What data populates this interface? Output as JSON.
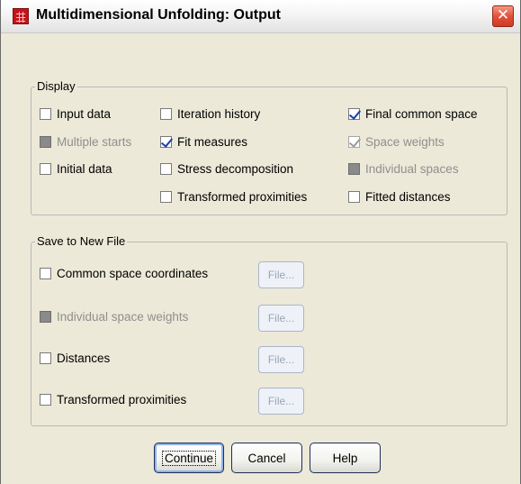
{
  "window": {
    "title": "Multidimensional Unfolding: Output",
    "close_symbol": "✕",
    "icon": "spreadsheet-icon"
  },
  "display": {
    "legend": "Display",
    "items": [
      {
        "label": "Input data",
        "checked": false,
        "enabled": true
      },
      {
        "label": "Multiple starts",
        "checked": false,
        "enabled": false
      },
      {
        "label": "Initial data",
        "checked": false,
        "enabled": true
      },
      {
        "label": "Iteration history",
        "checked": false,
        "enabled": true
      },
      {
        "label": "Fit measures",
        "checked": true,
        "enabled": true
      },
      {
        "label": "Stress decomposition",
        "checked": false,
        "enabled": true
      },
      {
        "label": "Transformed proximities",
        "checked": false,
        "enabled": true
      },
      {
        "label": "Final common space",
        "checked": true,
        "enabled": true
      },
      {
        "label": "Space weights",
        "checked": true,
        "enabled": false
      },
      {
        "label": "Individual spaces",
        "checked": false,
        "enabled": false
      },
      {
        "label": "Fitted distances",
        "checked": false,
        "enabled": true
      }
    ]
  },
  "save": {
    "legend": "Save to New File",
    "file_label": "File...",
    "items": [
      {
        "label": "Common space coordinates",
        "checked": false,
        "enabled": true
      },
      {
        "label": "Individual space weights",
        "checked": false,
        "enabled": false
      },
      {
        "label": "Distances",
        "checked": false,
        "enabled": true
      },
      {
        "label": "Transformed proximities",
        "checked": false,
        "enabled": true
      }
    ]
  },
  "buttons": {
    "continue": "Continue",
    "cancel": "Cancel",
    "help": "Help"
  }
}
